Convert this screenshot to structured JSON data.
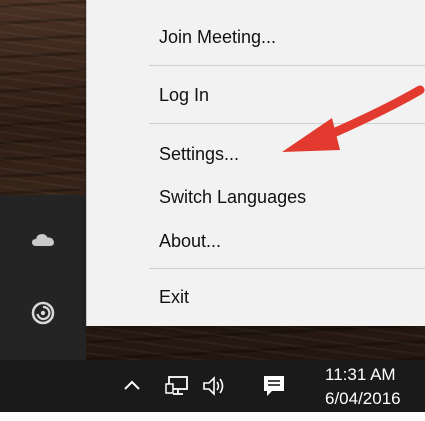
{
  "context_menu": {
    "items": [
      {
        "label": "Join Meeting..."
      },
      {
        "label": "Log In"
      },
      {
        "label": "Settings..."
      },
      {
        "label": "Switch Languages"
      },
      {
        "label": "About..."
      },
      {
        "label": "Exit"
      }
    ]
  },
  "annotation": {
    "arrow_color": "#e23a2e"
  },
  "tray_flyout": {
    "icons": [
      "cloud-icon",
      "spiral-app-icon"
    ]
  },
  "taskbar": {
    "icons": [
      "show-hidden-icons-chevron-icon",
      "network-icon",
      "volume-icon",
      "action-center-icon"
    ],
    "clock_time": "11:31 AM",
    "clock_date": "6/04/2016"
  }
}
